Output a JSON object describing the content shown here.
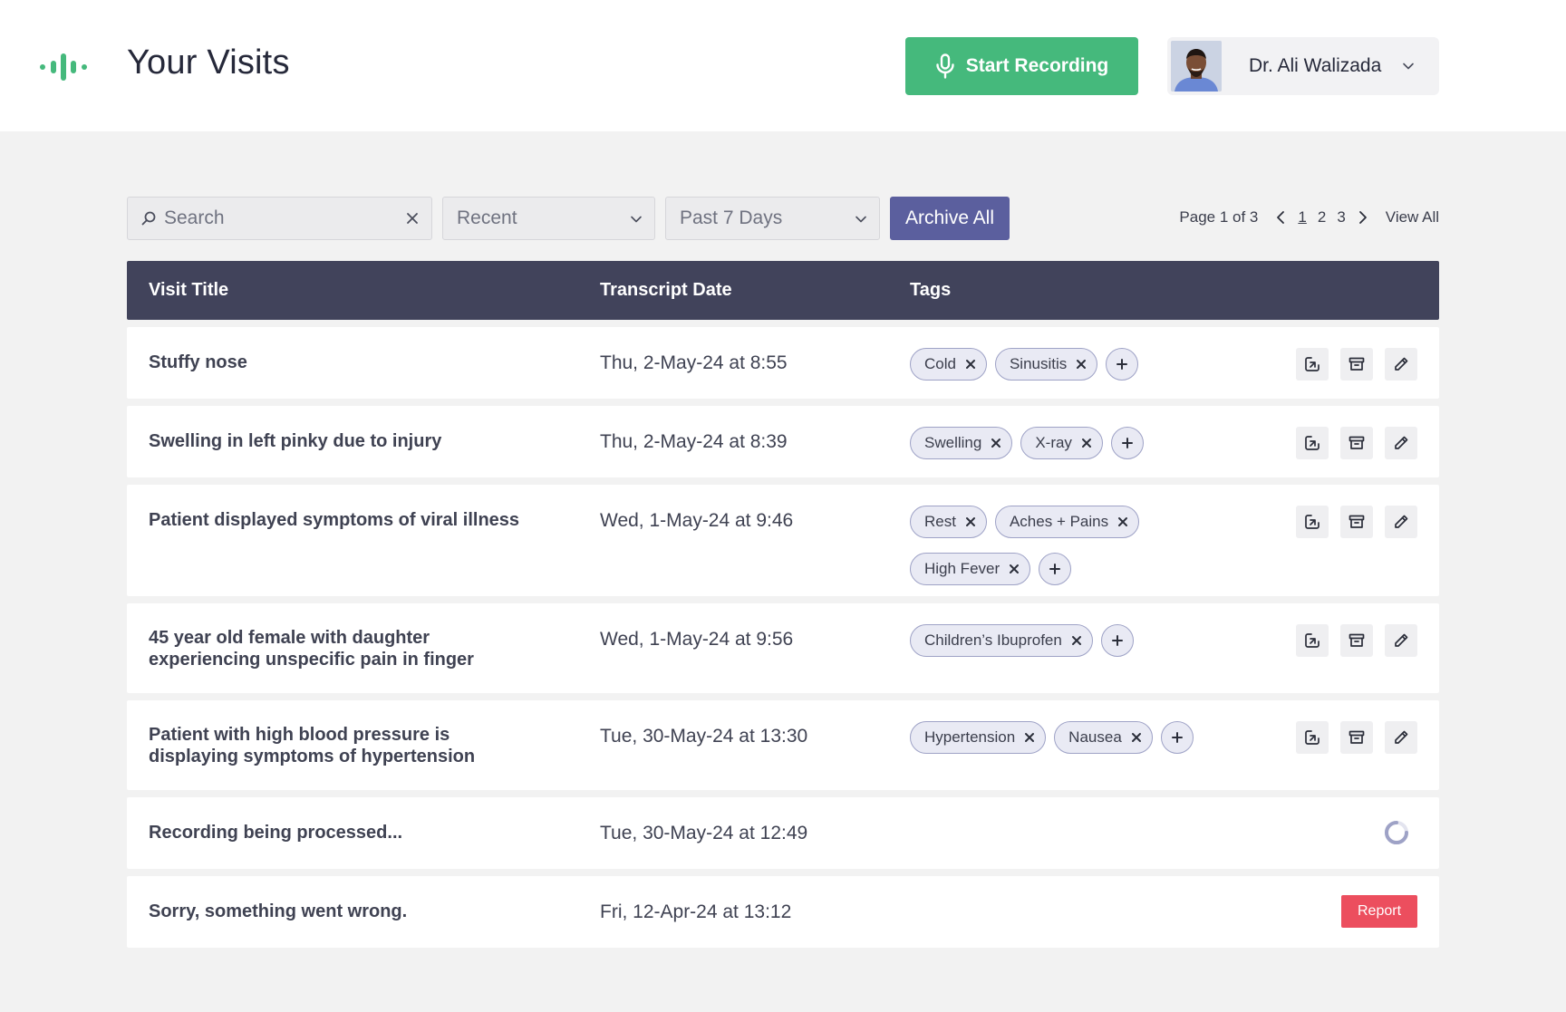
{
  "header": {
    "title": "Your Visits",
    "record_button": "Start Recording",
    "user_name": "Dr. Ali Walizada"
  },
  "toolbar": {
    "search_placeholder": "Search",
    "sort_value": "Recent",
    "range_value": "Past 7 Days",
    "archive_label": "Archive All"
  },
  "pagination": {
    "info": "Page 1 of 3",
    "pages": [
      "1",
      "2",
      "3"
    ],
    "current": "1",
    "view_all": "View All"
  },
  "table": {
    "headers": {
      "title": "Visit Title",
      "date": "Transcript Date",
      "tags": "Tags"
    },
    "rows": [
      {
        "title": "Stuffy nose",
        "date": "Thu, 2-May-24 at 8:55",
        "tags": [
          "Cold",
          "Sinusitis"
        ],
        "status": "done"
      },
      {
        "title": "Swelling in left pinky due to injury",
        "date": "Thu, 2-May-24 at 8:39",
        "tags": [
          "Swelling",
          "X-ray"
        ],
        "status": "done"
      },
      {
        "title": "Patient displayed symptoms of viral illness",
        "date": "Wed, 1-May-24 at 9:46",
        "tags": [
          "Rest",
          "Aches + Pains",
          "High Fever"
        ],
        "status": "done"
      },
      {
        "title": "45 year old female with daughter experiencing unspecific pain in finger",
        "date": "Wed, 1-May-24 at 9:56",
        "tags": [
          "Children’s Ibuprofen"
        ],
        "status": "done"
      },
      {
        "title": "Patient with high blood pressure is displaying symptoms of hypertension",
        "date": "Tue, 30-May-24 at 13:30",
        "tags": [
          "Hypertension",
          "Nausea"
        ],
        "status": "done"
      },
      {
        "title": "Recording being processed...",
        "date": "Tue, 30-May-24 at 12:49",
        "tags": [],
        "status": "processing"
      },
      {
        "title": "Sorry, something went wrong.",
        "date": "Fri, 12-Apr-24 at 13:12",
        "tags": [],
        "status": "error",
        "action_label": "Report"
      }
    ]
  },
  "colors": {
    "brand_green": "#45b97c",
    "header_navy": "#41435b",
    "accent_indigo": "#5b5f9e",
    "error_red": "#ec4e5e",
    "tag_bg": "#e9eaf4"
  },
  "icons": {
    "logo": "waveform-logo-icon",
    "record": "microphone-icon",
    "search": "search-icon",
    "clear": "close-icon",
    "dropdown": "chevron-down-icon",
    "tag_remove": "close-icon",
    "tag_add": "plus-icon",
    "row_actions": [
      "open-in-icon",
      "archive-icon",
      "pencil-icon"
    ]
  }
}
